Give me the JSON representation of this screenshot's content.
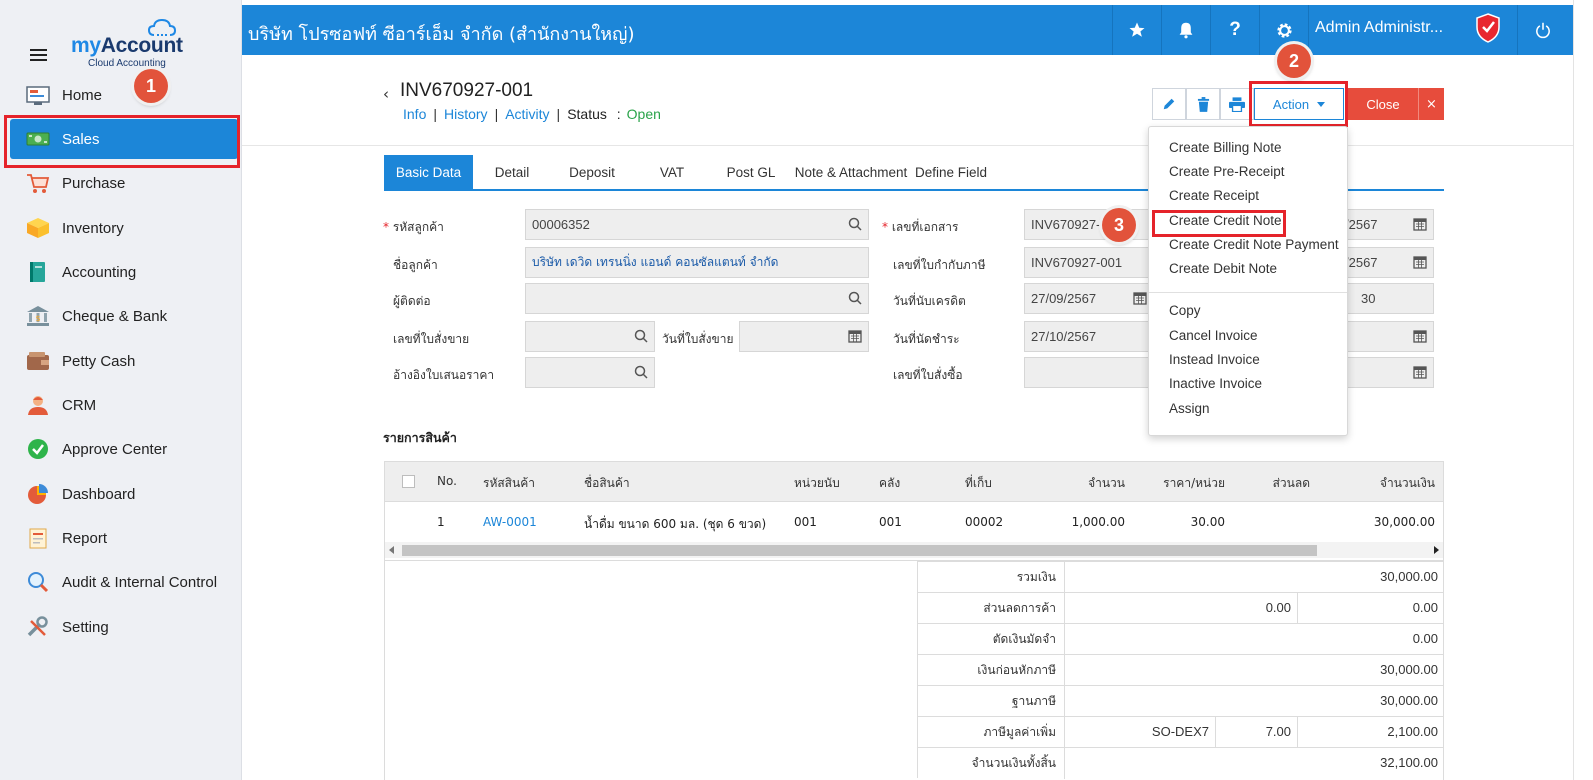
{
  "sidebar": {
    "logo_my": "my",
    "logo_account": "Account",
    "logo_sub": "Cloud Accounting",
    "items": [
      {
        "label": "Home",
        "icon": "home-icon"
      },
      {
        "label": "Sales",
        "icon": "cash-icon",
        "active": true
      },
      {
        "label": "Purchase",
        "icon": "cart-icon"
      },
      {
        "label": "Inventory",
        "icon": "box-icon"
      },
      {
        "label": "Accounting",
        "icon": "book-icon"
      },
      {
        "label": "Cheque & Bank",
        "icon": "bank-icon"
      },
      {
        "label": "Petty Cash",
        "icon": "wallet-icon"
      },
      {
        "label": "CRM",
        "icon": "people-icon"
      },
      {
        "label": "Approve Center",
        "icon": "check-circle-icon"
      },
      {
        "label": "Dashboard",
        "icon": "pie-chart-icon"
      },
      {
        "label": "Report",
        "icon": "report-icon"
      },
      {
        "label": "Audit & Internal Control",
        "icon": "magnifier-icon"
      },
      {
        "label": "Setting",
        "icon": "wrench-icon"
      }
    ]
  },
  "topbar": {
    "company": "บริษัท โปรซอฟท์ ซีอาร์เอ็ม จำกัด (สำนักงานใหญ่)",
    "user": "Admin Administr..."
  },
  "callouts": {
    "one": "1",
    "two": "2",
    "three": "3"
  },
  "document": {
    "back": "‹",
    "number": "INV670927-001",
    "links": {
      "info": "Info",
      "history": "History",
      "activity": "Activity"
    },
    "status_label": "Status",
    "status_colon": ":",
    "status_value": "Open"
  },
  "toolbar": {
    "action": "Action",
    "close": "Close",
    "close_x": "×"
  },
  "tabs": [
    "Basic Data",
    "Detail",
    "Deposit",
    "VAT",
    "Post GL",
    "Note & Attachment",
    "Define Field"
  ],
  "form": {
    "customer_code_label": "รหัสลูกค้า",
    "customer_code": "00006352",
    "customer_name_label": "ชื่อลูกค้า",
    "customer_name": "บริษัท เดวิด เทรนนิ่ง แอนด์ คอนซัลแตนท์ จำกัด",
    "contact_label": "ผู้ติดต่อ",
    "so_no_label": "เลขที่ใบสั่งขาย",
    "so_date_label": "วันที่ใบสั่งขาย",
    "quotation_label": "อ้างอิงใบเสนอราคา",
    "doc_no_label": "เลขที่เอกสาร",
    "doc_no": "INV670927-0",
    "doc_date": "/2567",
    "tax_inv_label": "เลขที่ใบกำกับภาษี",
    "tax_inv": "INV670927-001",
    "tax_inv_date": "/2567",
    "credit_start_label": "วันที่นับเครดิต",
    "credit_start": "27/09/2567",
    "credit_days": "30",
    "due_date_label": "วันที่นัดชำระ",
    "due_date": "27/10/2567",
    "po_no_label": "เลขที่ใบสั่งซื้อ"
  },
  "action_menu": [
    "Create Billing Note",
    "Create Pre-Receipt",
    "Create Receipt",
    "Create Credit Note",
    "Create Credit Note Payment",
    "Create Debit Note",
    "Copy",
    "Cancel Invoice",
    "Instead Invoice",
    "Inactive Invoice",
    "Assign"
  ],
  "items": {
    "title": "รายการสินค้า",
    "headers": [
      "No.",
      "รหัสสินค้า",
      "ชื่อสินค้า",
      "หน่วยนับ",
      "คลัง",
      "ที่เก็บ",
      "จำนวน",
      "ราคา/หน่วย",
      "ส่วนลด",
      "จำนวนเงิน"
    ],
    "rows": [
      [
        "1",
        "AW-0001",
        "น้ำดื่ม ขนาด 600 มล. (ชุด 6 ขวด)",
        "001",
        "001",
        "00002",
        "1,000.00",
        "30.00",
        "",
        "30,000.00"
      ]
    ]
  },
  "totals": [
    {
      "label": "รวมเงิน",
      "value": "30,000.00"
    },
    {
      "label": "ส่วนลดการค้า",
      "rate": "0.00",
      "value": "0.00"
    },
    {
      "label": "ตัดเงินมัดจำ",
      "value": "0.00"
    },
    {
      "label": "เงินก่อนหักภาษี",
      "value": "30,000.00"
    },
    {
      "label": "ฐานภาษี",
      "value": "30,000.00"
    },
    {
      "label": "ภาษีมูลค่าเพิ่ม",
      "code": "SO-DEX7",
      "rate": "7.00",
      "value": "2,100.00"
    },
    {
      "label": "จำนวนเงินทั้งสิ้น",
      "value": "32,100.00"
    }
  ]
}
